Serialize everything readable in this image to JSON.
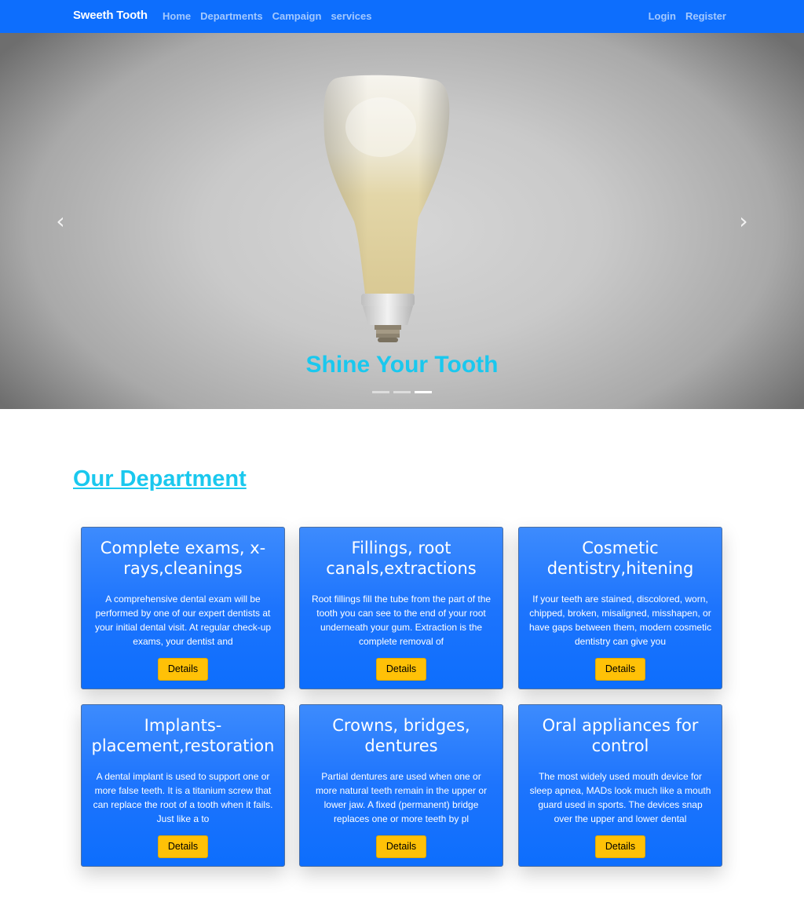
{
  "navbar": {
    "brand": "Sweeth Tooth",
    "links": [
      "Home",
      "Departments",
      "Campaign",
      "services"
    ],
    "auth": [
      "Login",
      "Register"
    ]
  },
  "carousel": {
    "caption": "Shine Your Tooth",
    "prev_icon": "chevron-left-icon",
    "next_icon": "chevron-right-icon",
    "prev_glyph": "‹",
    "next_glyph": "›",
    "active_slide": 3,
    "slide_count": 3
  },
  "section": {
    "title": "Our Department"
  },
  "cards": [
    {
      "title": "Complete exams, x-rays,cleanings",
      "text": "A comprehensive dental exam will be performed by one of our expert dentists at your initial dental visit. At regular check-up exams, your dentist and",
      "button": "Details"
    },
    {
      "title": "Fillings, root canals,extractions",
      "text": "Root fillings fill the tube from the part of the tooth you can see to the end of your root underneath your gum. Extraction is the complete removal of",
      "button": "Details"
    },
    {
      "title": "Cosmetic dentistry,hitening",
      "text": "If your teeth are stained, discolored, worn, chipped, broken, misaligned, misshapen, or have gaps between them, modern cosmetic dentistry can give you",
      "button": "Details"
    },
    {
      "title": "Implants-placement,restoration",
      "text": "A dental implant is used to support one or more false teeth. It is a titanium screw that can replace the root of a tooth when it fails. Just like a to",
      "button": "Details"
    },
    {
      "title": "Crowns, bridges, dentures",
      "text": "Partial dentures are used when one or more natural teeth remain in the upper or lower jaw. A fixed (permanent) bridge replaces one or more teeth by pl",
      "button": "Details"
    },
    {
      "title": "Oral appliances for control",
      "text": "The most widely used mouth device for sleep apnea, MADs look much like a mouth guard used in sports. The devices snap over the upper and lower dental",
      "button": "Details"
    }
  ],
  "colors": {
    "primary": "#0d6efd",
    "accent": "#1ac8ee",
    "button": "#ffc107"
  }
}
